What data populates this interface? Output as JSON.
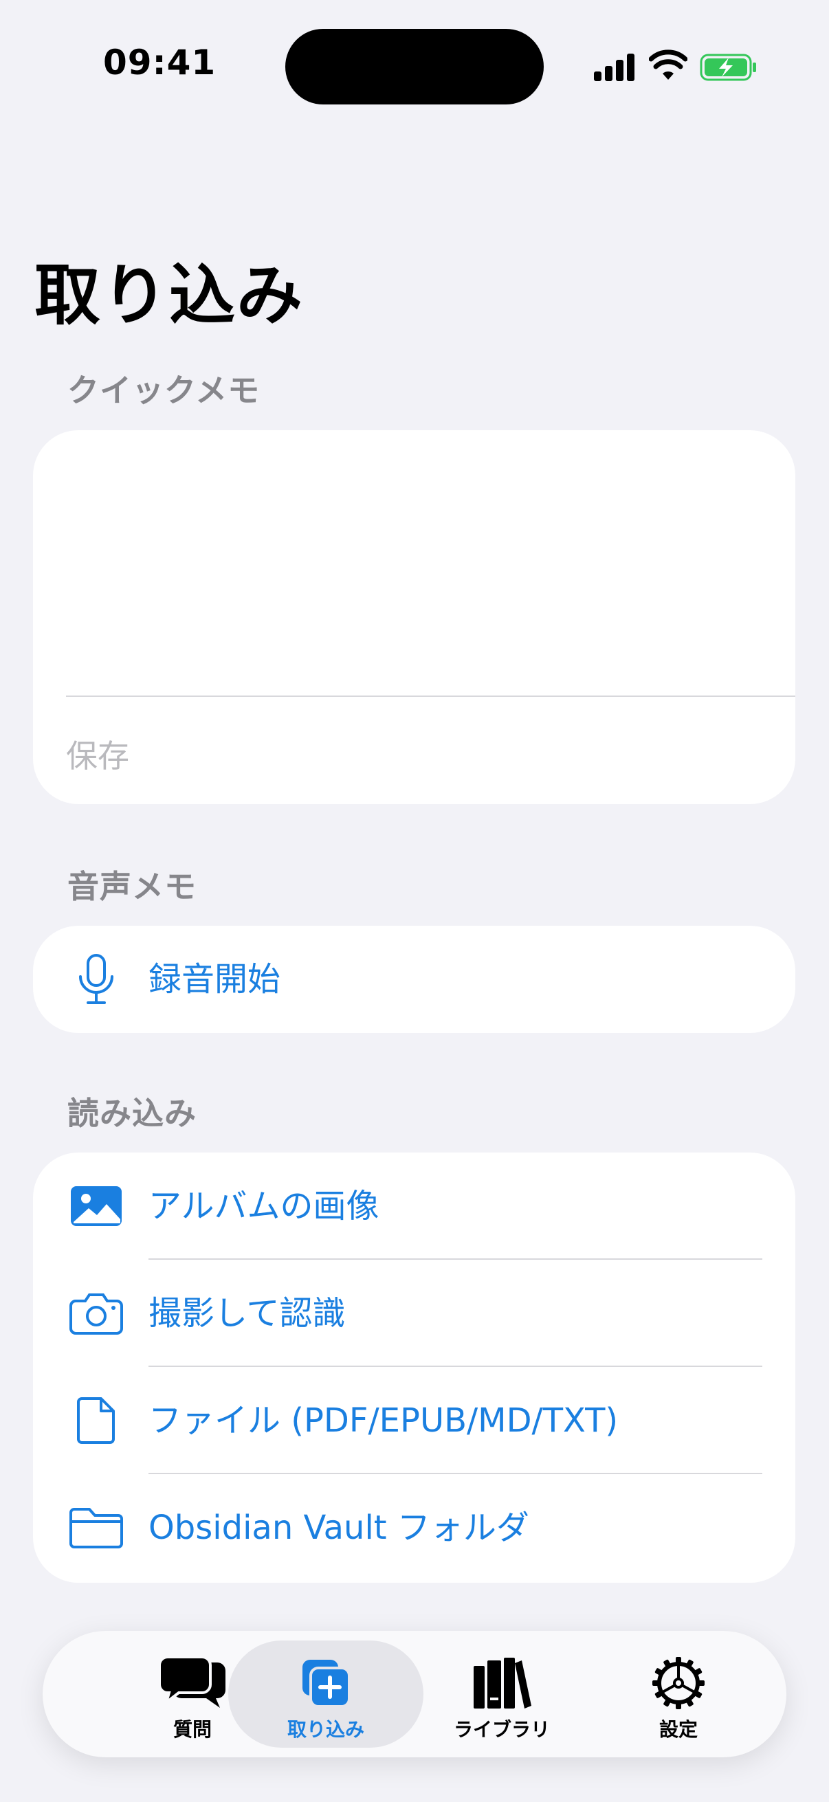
{
  "status_bar": {
    "time": "09:41"
  },
  "page": {
    "title": "取り込み"
  },
  "quick_memo": {
    "header": "クイックメモ",
    "value": "",
    "save_label": "保存"
  },
  "voice_memo": {
    "header": "音声メモ",
    "record_label": "録音開始"
  },
  "import": {
    "header": "読み込み",
    "items": [
      {
        "label": "アルバムの画像",
        "icon": "photo-icon"
      },
      {
        "label": "撮影して認識",
        "icon": "camera-icon"
      },
      {
        "label": "ファイル (PDF/EPUB/MD/TXT)",
        "icon": "document-icon"
      },
      {
        "label": "Obsidian Vault フォルダ",
        "icon": "folder-icon"
      }
    ]
  },
  "tab_bar": {
    "active": "import",
    "tabs": [
      {
        "label": "質問",
        "icon": "chat-bubbles-icon"
      },
      {
        "label": "取り込み",
        "icon": "add-stack-icon"
      },
      {
        "label": "ライブラリ",
        "icon": "books-icon"
      },
      {
        "label": "設定",
        "icon": "gear-icon"
      }
    ]
  },
  "colors": {
    "accent": "#1a7fe0",
    "background": "#f2f2f7",
    "card": "#ffffff",
    "secondary_text": "#86868b",
    "battery": "#34c759"
  }
}
